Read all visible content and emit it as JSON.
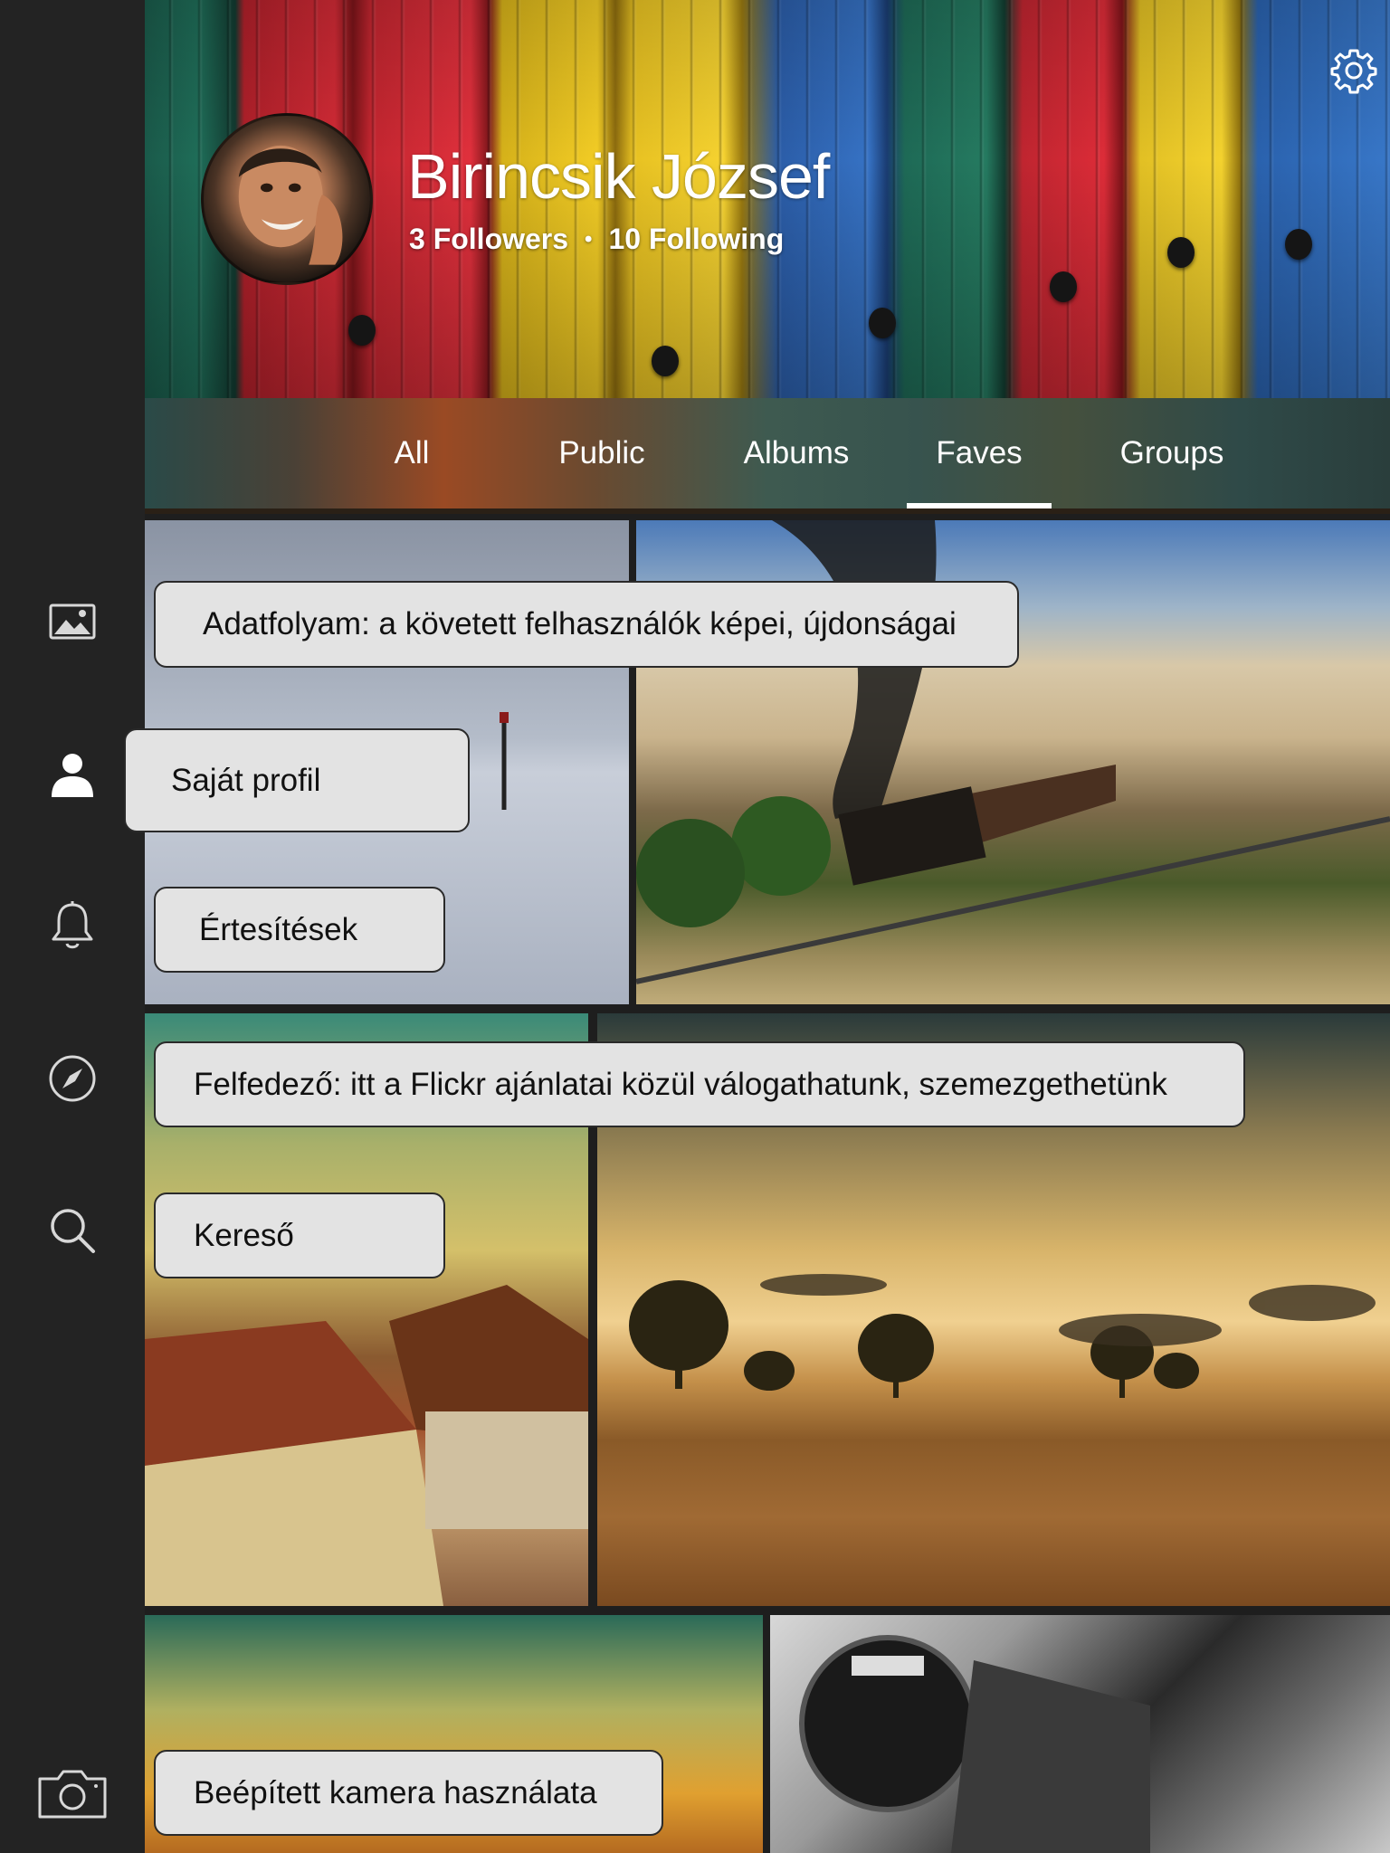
{
  "profile": {
    "name": "Birincsik József",
    "followers": "3 Followers",
    "separator": "•",
    "following": "10 Following"
  },
  "tabs": [
    {
      "label": "All",
      "active": false
    },
    {
      "label": "Public",
      "active": false
    },
    {
      "label": "Albums",
      "active": false
    },
    {
      "label": "Faves",
      "active": true
    },
    {
      "label": "Groups",
      "active": false
    }
  ],
  "sidebar": {
    "icons": [
      "photostream-icon",
      "profile-icon",
      "notifications-icon",
      "explore-compass-icon",
      "search-icon",
      "camera-icon"
    ]
  },
  "callouts": {
    "feed": "Adatfolyam: a követett felhasználók képei, újdonságai",
    "profile": "Saját profil",
    "notifications": "Értesítések",
    "explore": "Felfedező: itt a Flickr ajánlatai közül válogathatunk, szemezgethetünk",
    "search": "Kereső",
    "camera": "Beépített kamera használata"
  },
  "colors": {
    "sidebar": "#232323",
    "callout_bg": "#e3e3e3",
    "tab_text": "#ffffff"
  }
}
